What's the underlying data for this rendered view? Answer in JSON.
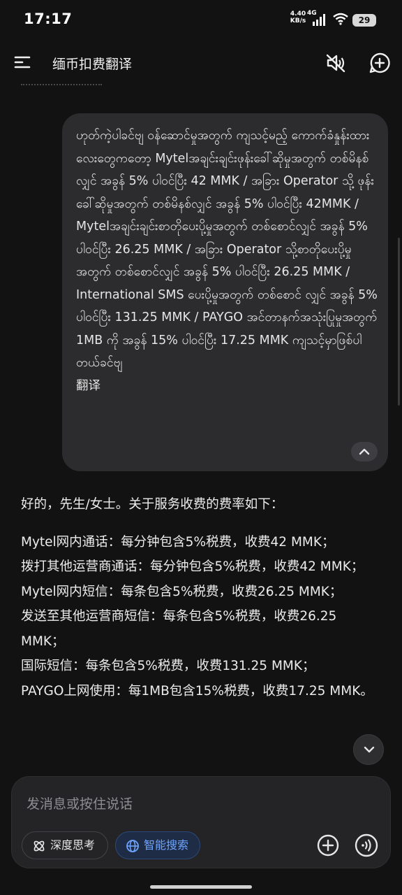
{
  "status_bar": {
    "time": "17:17",
    "net_speed": "4.40 KB/s",
    "network_type": "4G",
    "battery": "29",
    "icons": [
      "signal-icon",
      "wifi-icon",
      "battery-icon"
    ]
  },
  "header": {
    "title": "缅币扣费翻译",
    "icons": [
      "menu-icon",
      "mute-icon",
      "new-chat-icon"
    ]
  },
  "user_message": {
    "text": "ဟုတ်ကဲ့ပါခင်ဗျ ဝန်ဆောင်မှုအတွက် ကျသင့်မည့် ကောက်ခံနှုန်းထားလေးတွေကတော့ Mytelအချင်းချင်းဖုန်းခေါ်ဆိုမှုအတွက် တစ်မိနစ်လျှင် အခွန် 5% ပါဝင်ပြီး 42 MMK / အခြား Operator သို့ ဖုန်းခေါ်ဆိုမှုအတွက် တစ်မိနစ်လျှင် အခွန် 5% ပါဝင်ပြီး 42MMK / Mytelအချင်းချင်းစာတိုပေးပို့မှုအတွက် တစ်စောင်လျှင် အခွန် 5% ပါဝင်ပြီး 26.25 MMK / အခြား Operator သို့စာတိုပေးပို့မှုအတွက် တစ်စောင်လျှင် အခွန် 5% ပါဝင်ပြီး 26.25 MMK / International SMS ပေးပို့မှုအတွက် တစ်စောင် လျှင် အခွန် 5% ပါဝင်ပြီး 131.25 MMK / PAYGO အင်တာနက်အသုံးပြုမှုအတွက် 1MB ကို အခွန် 15% ပါဝင်ပြီး 17.25 MMK ကျသင့်မှာဖြစ်ပါတယ်ခင်ဗျ\n翻译",
    "collapse_icon": "chevron-up-icon"
  },
  "assistant_reply": {
    "intro": "好的，先生/女士。关于服务收费的费率如下：",
    "lines": [
      "Mytel网内通话：每分钟包含5%税费，收费42 MMK；",
      "拨打其他运营商通话：每分钟包含5%税费，收费42 MMK；",
      "Mytel网内短信：每条包含5%税费，收费26.25 MMK；",
      "发送至其他运营商短信：每条包含5%税费，收费26.25 MMK；",
      "国际短信：每条包含5%税费，收费131.25 MMK；",
      "PAYGO上网使用：每1MB包含15%税费，收费17.25 MMK。"
    ]
  },
  "composer": {
    "placeholder": "发消息或按住说话",
    "deep_think_label": "深度思考",
    "smart_search_label": "智能搜索",
    "accent_color": "#6ea4ff"
  }
}
